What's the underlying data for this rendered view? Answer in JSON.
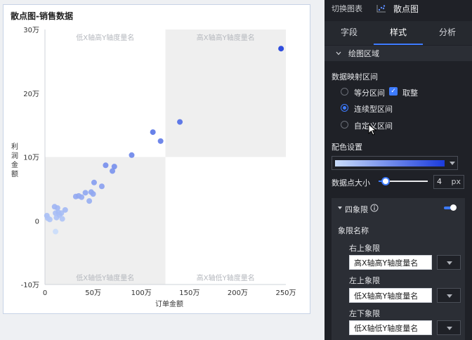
{
  "chart_card": {
    "title": "散点图-销售数据",
    "xlabel": "订单金额",
    "ylabel": "利润金额",
    "quadrant_labels": {
      "top_left": "低X轴高Y轴度量名",
      "top_right": "高X轴高Y轴度量名",
      "bottom_left": "低X轴低Y轴度量名",
      "bottom_right": "高X轴低Y轴度量名"
    }
  },
  "chart_data": {
    "type": "scatter",
    "title": "散点图-销售数据",
    "xlabel": "订单金额",
    "ylabel": "利润金额",
    "xlim": [
      0,
      250
    ],
    "ylim": [
      -10,
      30
    ],
    "x_unit": "万",
    "y_unit": "万",
    "x_ticks": [
      "0",
      "50万",
      "100万",
      "150万",
      "200万",
      "250万"
    ],
    "y_ticks": [
      "-10万",
      "0",
      "10万",
      "20万",
      "30万"
    ],
    "quadrant_split": {
      "x": 125,
      "y": 10
    },
    "grid": false,
    "color_scale": [
      "#c9dcfb",
      "#1b3bdc"
    ],
    "points": [
      {
        "x": 2,
        "y": 0.8
      },
      {
        "x": 3,
        "y": 0.4
      },
      {
        "x": 5,
        "y": 0.2
      },
      {
        "x": 10,
        "y": 2.2
      },
      {
        "x": 11,
        "y": 1.2
      },
      {
        "x": 12,
        "y": 0.5
      },
      {
        "x": 13,
        "y": 2
      },
      {
        "x": 14,
        "y": 1.3
      },
      {
        "x": 15,
        "y": 0.9
      },
      {
        "x": 17,
        "y": 1.2
      },
      {
        "x": 18,
        "y": 0.3
      },
      {
        "x": 21,
        "y": 1.7
      },
      {
        "x": 11,
        "y": -1.7
      },
      {
        "x": 32,
        "y": 3.8
      },
      {
        "x": 35,
        "y": 3.9
      },
      {
        "x": 38,
        "y": 3.7
      },
      {
        "x": 42,
        "y": 4.4
      },
      {
        "x": 46,
        "y": 3.1
      },
      {
        "x": 48,
        "y": 4.5
      },
      {
        "x": 50,
        "y": 4.2
      },
      {
        "x": 51,
        "y": 6
      },
      {
        "x": 59,
        "y": 5.4
      },
      {
        "x": 63,
        "y": 8.7
      },
      {
        "x": 70,
        "y": 7.8
      },
      {
        "x": 72,
        "y": 8.5
      },
      {
        "x": 90,
        "y": 10.3
      },
      {
        "x": 112,
        "y": 13.9
      },
      {
        "x": 120,
        "y": 12.5
      },
      {
        "x": 140,
        "y": 15.5
      },
      {
        "x": 245,
        "y": 27
      }
    ]
  },
  "panel": {
    "switch_chart_label": "切换图表",
    "current_chart": "散点图",
    "tabs": [
      "字段",
      "样式",
      "分析"
    ],
    "active_tab": "样式",
    "section_title": "绘图区域",
    "data_mapping": {
      "label": "数据映射区间",
      "options": [
        "等分区间",
        "连续型区间",
        "自定义区间"
      ],
      "selected": "连续型区间",
      "round_label": "取整",
      "round_checked": true
    },
    "color_setting_label": "配色设置",
    "point_size": {
      "label": "数据点大小",
      "value": "4",
      "unit": "px",
      "fraction": 0.1
    },
    "quadrant": {
      "title": "四象限",
      "enabled": true,
      "name_label": "象限名称",
      "items": [
        {
          "label": "右上象限",
          "value": "高X轴高Y轴度量名"
        },
        {
          "label": "左上象限",
          "value": "低X轴高Y轴度量名"
        },
        {
          "label": "左下象限",
          "value": "低X轴低Y轴度量名"
        }
      ]
    }
  }
}
